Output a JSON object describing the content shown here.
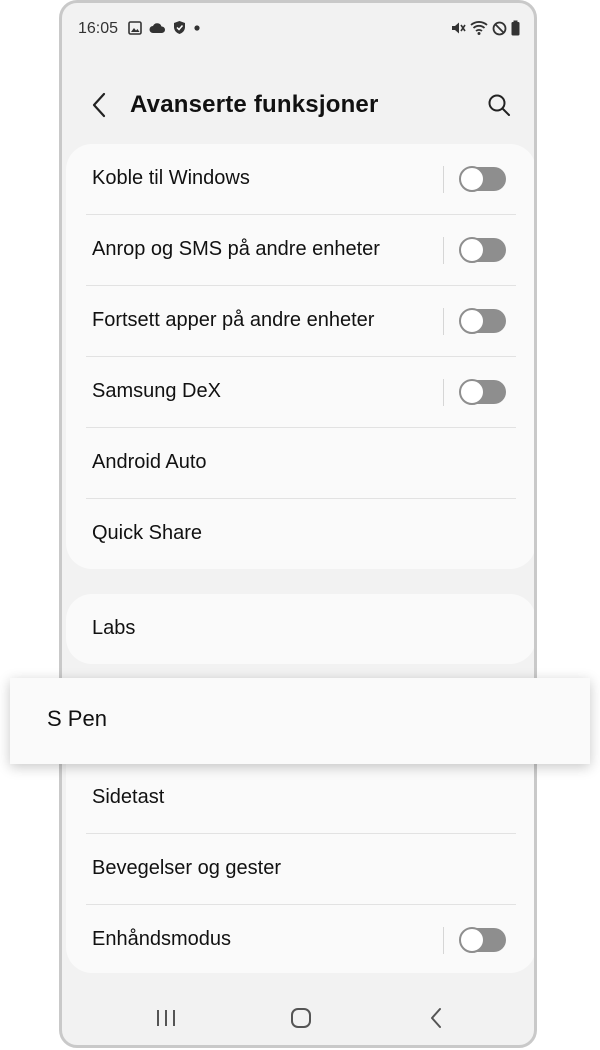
{
  "status": {
    "time": "16:05",
    "left_icons": [
      "gallery-icon",
      "cloud-icon",
      "shield-icon",
      "dot-icon"
    ],
    "right_icons": [
      "mute-icon",
      "wifi-icon",
      "dnd-icon",
      "battery-icon"
    ]
  },
  "header": {
    "title": "Avanserte funksjoner"
  },
  "group1": [
    {
      "label": "Koble til Windows",
      "toggle": false
    },
    {
      "label": "Anrop og SMS på andre enheter",
      "toggle": false
    },
    {
      "label": "Fortsett apper på andre enheter",
      "toggle": false
    },
    {
      "label": "Samsung DeX",
      "toggle": false
    },
    {
      "label": "Android Auto"
    },
    {
      "label": "Quick Share"
    }
  ],
  "group2": [
    {
      "label": "Labs"
    }
  ],
  "highlight": {
    "label": "S Pen"
  },
  "group3": [
    {
      "label": "Sidetast"
    },
    {
      "label": "Bevegelser og gester"
    },
    {
      "label": "Enhåndsmodus",
      "toggle": false
    }
  ],
  "navbar": [
    "recents-icon",
    "home-icon",
    "back-icon"
  ]
}
